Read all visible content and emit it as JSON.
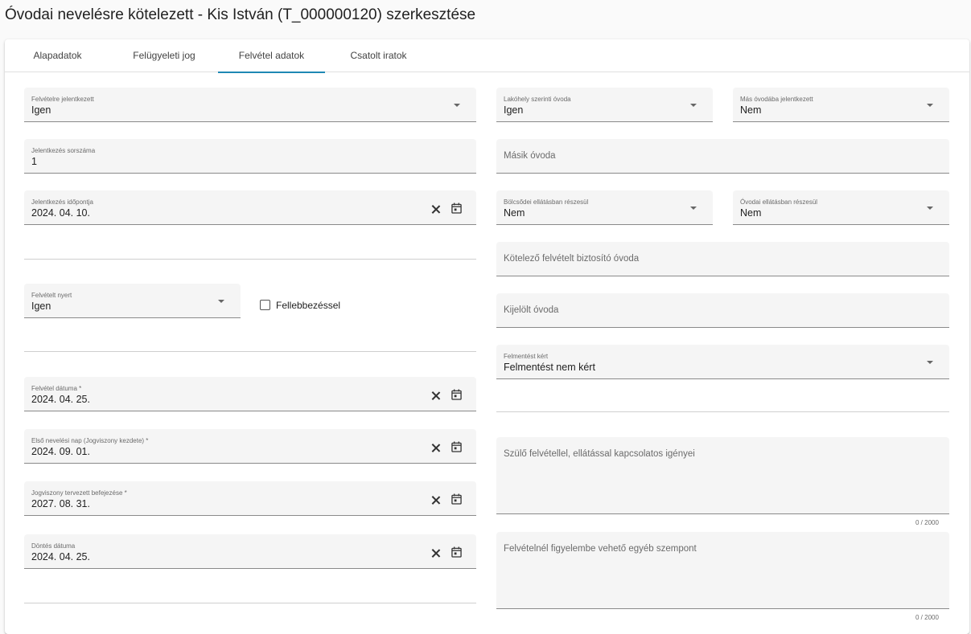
{
  "page_title": "Óvodai nevelésre kötelezett - Kis István (T_000000120) szerkesztése",
  "tabs": [
    {
      "label": "Alapadatok"
    },
    {
      "label": "Felügyeleti jog"
    },
    {
      "label": "Felvétel adatok"
    },
    {
      "label": "Csatolt iratok"
    }
  ],
  "active_tab": "Felvétel adatok",
  "left": {
    "felvetelre_jelentkezett": {
      "label": "Felvételre jelentkezett",
      "value": "Igen"
    },
    "jelentkezes_sorszama": {
      "label": "Jelentkezés sorszáma",
      "value": "1"
    },
    "jelentkezes_idopontja": {
      "label": "Jelentkezés időpontja",
      "value": "2024. 04. 10."
    },
    "felvetelt_nyert": {
      "label": "Felvételt nyert",
      "value": "Igen"
    },
    "fellebbezessel": {
      "label": "Fellebbezéssel",
      "checked": false
    },
    "felvetel_datuma": {
      "label": "Felvétel dátuma *",
      "value": "2024. 04. 25."
    },
    "elso_nevelesi_nap": {
      "label": "Első nevelési nap (Jogviszony kezdete) *",
      "value": "2024. 09. 01."
    },
    "jogviszony_befejezese": {
      "label": "Jogviszony tervezett befejezése *",
      "value": "2027. 08. 31."
    },
    "dontes_datuma": {
      "label": "Döntés dátuma",
      "value": "2024. 04. 25."
    }
  },
  "right": {
    "lakohely_szerinti_ovoda": {
      "label": "Lakóhely szerinti óvoda",
      "value": "Igen"
    },
    "mas_ovodaba_jelentkezett": {
      "label": "Más óvodába jelentkezett",
      "value": "Nem"
    },
    "masik_ovoda": {
      "placeholder": "Másik óvoda"
    },
    "bolcsodei_ellatas": {
      "label": "Bölcsődei ellátásban részesül",
      "value": "Nem"
    },
    "ovodai_ellatas": {
      "label": "Óvodai ellátásban részesül",
      "value": "Nem"
    },
    "kotelezo_felvetel": {
      "placeholder": "Kötelező felvételt biztosító óvoda"
    },
    "kijelolt_ovoda": {
      "placeholder": "Kijelölt óvoda"
    },
    "felmentest_kert": {
      "label": "Felmentést kért",
      "value": "Felmentést nem kért"
    },
    "szulo_igenyei": {
      "placeholder": "Szülő felvétellel, ellátással kapcsolatos igényei",
      "counter": "0 / 2000"
    },
    "egyeb_szempont": {
      "placeholder": "Felvételnél figyelembe vehető egyéb szempont",
      "counter": "0 / 2000"
    }
  }
}
